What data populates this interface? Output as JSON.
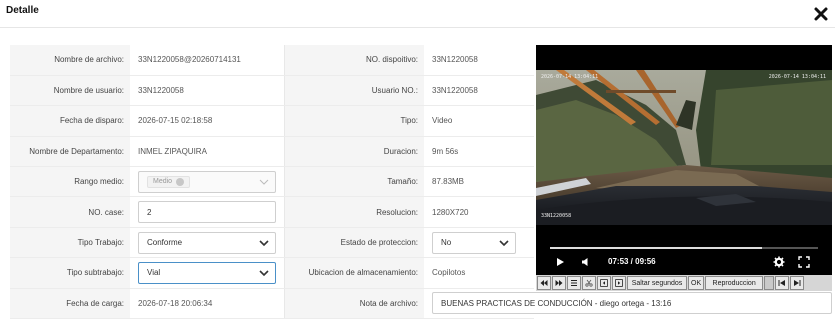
{
  "dialog": {
    "title": "Detalle"
  },
  "icons": {
    "close": "close-x-icon"
  },
  "rows": [
    {
      "l1": "Nombre de archivo:",
      "v1": "33N1220058@20260714131",
      "l2": "NO. dispoitivo:",
      "v2": "33N1220058"
    },
    {
      "l1": "Nombre de usuario:",
      "v1": "33N1220058",
      "l2": "Usuario NO.:",
      "v2": "33N1220058"
    },
    {
      "l1": "Fecha de disparo:",
      "v1": "2026-07-15 02:18:58",
      "l2": "Tipo:",
      "v2": "Video"
    },
    {
      "l1": "Nombre de Departamento:",
      "v1": "INMEL ZIPAQUIRA",
      "l2": "Duracion:",
      "v2": "9m 56s"
    },
    {
      "l1": "Rango medio:",
      "v1": "Medio",
      "l2": "Tamaño:",
      "v2": "87.83MB"
    },
    {
      "l1": "NO. case:",
      "v1": "2",
      "l2": "Resolucion:",
      "v2": "1280X720"
    },
    {
      "l1": "Tipo Trabajo:",
      "v1": "Conforme",
      "l2": "Estado de proteccion:",
      "v2": "No"
    },
    {
      "l1": "Tipo subtrabajo:",
      "v1": "Vial",
      "l2": "Ubicacion de almacenamiento:",
      "v2": "Copilotos"
    },
    {
      "l1": "Fecha de carga:",
      "v1": "2026-07-18 20:06:34",
      "l2": "Nota de archivo:",
      "v2": "BUENAS PRACTICAS DE CONDUCCIÓN - diego ortega - 13:16"
    }
  ],
  "player": {
    "osd_top_left": "2026-07-14 13:04:11",
    "osd_top_right": "2026-07-14 13:04:11",
    "osd_bottom": "33N1220058",
    "time_display": "07:53 / 09:56",
    "progress": 0.79,
    "toolbar": {
      "skip_label": "Saltar segundos",
      "ok_label": "OK",
      "playback_label": "Reproduccion"
    }
  }
}
